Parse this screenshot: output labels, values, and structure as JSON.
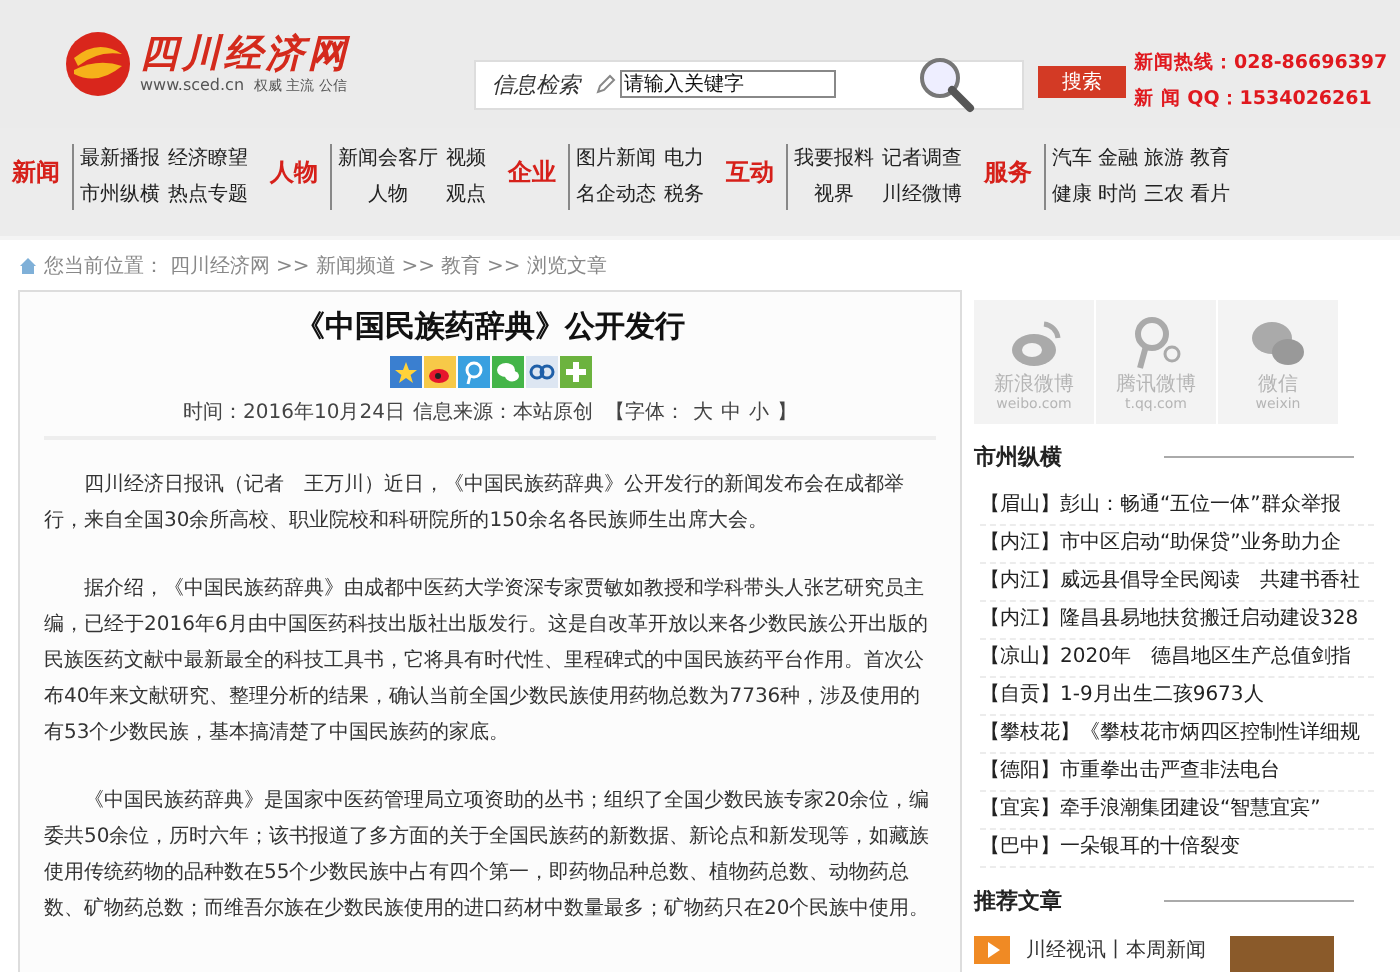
{
  "header": {
    "logo_text": "四川经济网",
    "logo_url": "www.sced.cn",
    "logo_slogan": "权威 主流 公信",
    "search_label": "信息检索",
    "search_placeholder": "请输入关键字",
    "search_button": "搜索",
    "hotlines": [
      "新闻热线：028-86696397",
      "新 闻 QQ：1534026261"
    ]
  },
  "nav": [
    {
      "heading": "新闻",
      "links": [
        "最新播报",
        "经济瞭望",
        "市州纵横",
        "热点专题"
      ]
    },
    {
      "heading": "人物",
      "links": [
        "新闻会客厅",
        "视频",
        "人物",
        "观点"
      ]
    },
    {
      "heading": "企业",
      "links": [
        "图片新闻",
        "电力",
        "名企动态",
        "税务"
      ]
    },
    {
      "heading": "互动",
      "links": [
        "我要报料",
        "记者调查",
        "视界",
        "川经微博"
      ]
    },
    {
      "heading": "服务",
      "links": [
        "汽车",
        "金融",
        "旅游",
        "教育",
        "健康",
        "时尚",
        "三农",
        "看片"
      ]
    }
  ],
  "breadcrumb": {
    "label": "您当前位置：",
    "items": [
      "四川经济网",
      "新闻频道",
      "教育",
      "浏览文章"
    ],
    "separator": ">>"
  },
  "article": {
    "title": "《中国民族药辞典》公开发行",
    "share_icons": [
      {
        "kind": "star"
      },
      {
        "kind": "weibo"
      },
      {
        "kind": "tqq"
      },
      {
        "kind": "wechat"
      },
      {
        "kind": "renren"
      },
      {
        "kind": "plus"
      }
    ],
    "time": "时间：2016年10月24日",
    "source": "信息来源：本站原创",
    "font_open": "【字体：",
    "font_sizes": [
      "大",
      "中",
      "小"
    ],
    "font_close": "】",
    "paragraphs": [
      "四川经济日报讯（记者　王万川）近日，《中国民族药辞典》公开发行的新闻发布会在成都举行，来自全国30余所高校、职业院校和科研院所的150余名各民族师生出席大会。",
      "据介绍，《中国民族药辞典》由成都中医药大学资深专家贾敏如教授和学科带头人张艺研究员主编，已经于2016年6月由中国医药科技出版社出版发行。这是自改革开放以来各少数民族公开出版的民族医药文献中最新最全的科技工具书，它将具有时代性、里程碑式的中国民族药平台作用。首次公布40年来文献研究、整理分析的结果，确认当前全国少数民族使用药物总数为7736种，涉及使用的有53个少数民族，基本搞清楚了中国民族药的家底。",
      "《中国民族药辞典》是国家中医药管理局立项资助的丛书；组织了全国少数民族专家20余位，编委共50余位，历时六年；该书报道了多方面的关于全国民族药的新数据、新论点和新发现等，如藏族使用传统药物的品种数在55个少数民族中占有四个第一，即药物品种总数、植物药总数、动物药总数、矿物药总数；而维吾尔族在少数民族使用的进口药材中数量最多；矿物药只在20个民族中使用。"
    ]
  },
  "sidebar": {
    "social": [
      {
        "kind": "weibo",
        "name": "新浪微博",
        "url": "weibo.com"
      },
      {
        "kind": "tqq",
        "name": "腾讯微博",
        "url": "t.qq.com"
      },
      {
        "kind": "wechat",
        "name": "微信",
        "url": "weixin"
      }
    ],
    "region_heading": "市州纵横",
    "region_news": [
      {
        "region": "【眉山】",
        "title": "彭山：畅通“五位一体”群众举报"
      },
      {
        "region": "【内江】",
        "title": "市中区启动“助保贷”业务助力企"
      },
      {
        "region": "【内江】",
        "title": "威远县倡导全民阅读　共建书香社"
      },
      {
        "region": "【内江】",
        "title": "隆昌县易地扶贫搬迁启动建设328"
      },
      {
        "region": "【凉山】",
        "title": "2020年　德昌地区生产总值剑指"
      },
      {
        "region": "【自贡】",
        "title": "1-9月出生二孩9673人"
      },
      {
        "region": "【攀枝花】",
        "title": "《攀枝花市炳四区控制性详细规"
      },
      {
        "region": "【德阳】",
        "title": "市重拳出击严查非法电台"
      },
      {
        "region": "【宜宾】",
        "title": "牵手浪潮集团建设“智慧宜宾”"
      },
      {
        "region": "【巴中】",
        "title": "一朵银耳的十倍裂变"
      }
    ],
    "recommend_heading": "推荐文章",
    "recommend": [
      {
        "title": "川经视讯丨本周新闻"
      }
    ]
  }
}
